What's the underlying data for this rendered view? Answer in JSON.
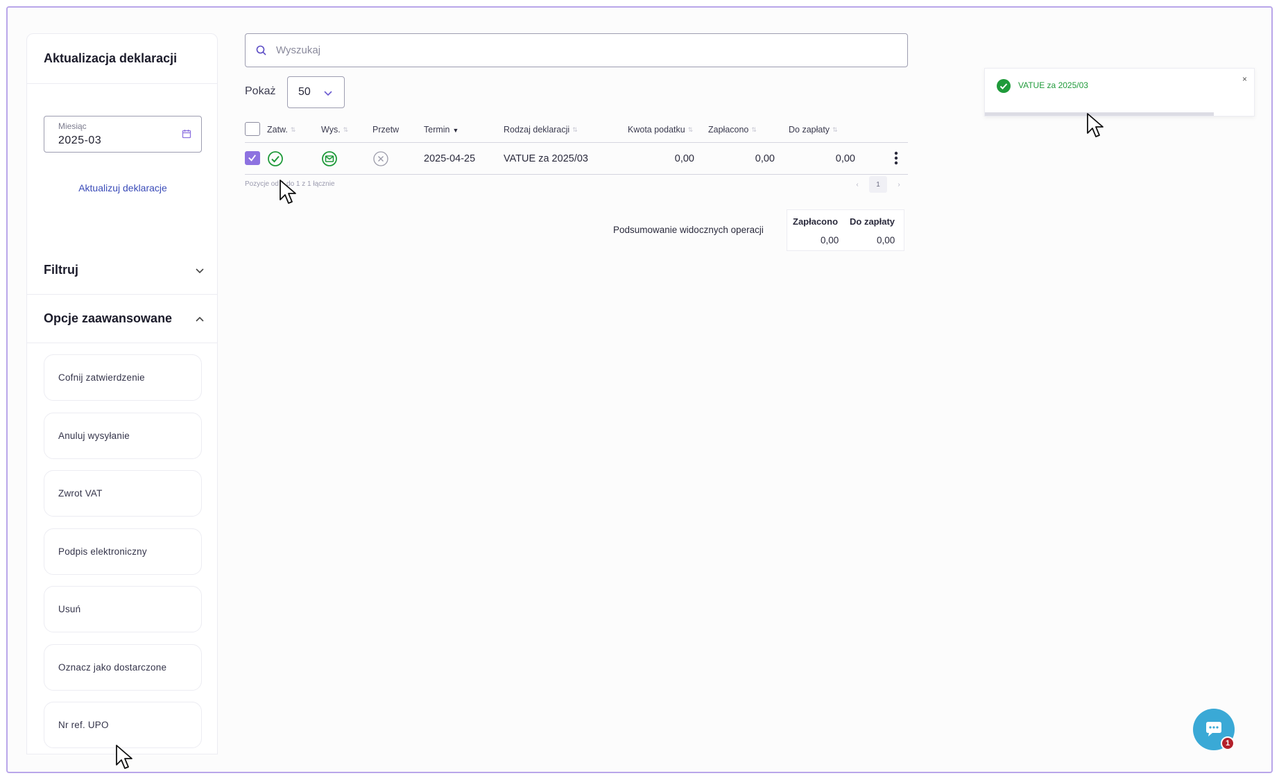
{
  "sidebar": {
    "title": "Aktualizacja deklaracji",
    "month_field": {
      "label": "Miesiąc",
      "value": "2025-03"
    },
    "update_link": "Aktualizuj deklaracje",
    "filter_label": "Filtruj",
    "advanced_label": "Opcje zaawansowane",
    "options": [
      "Cofnij zatwierdzenie",
      "Anuluj wysyłanie",
      "Zwrot VAT",
      "Podpis elektroniczny",
      "Usuń",
      "Oznacz jako dostarczone",
      "Nr ref. UPO"
    ]
  },
  "search": {
    "placeholder": "Wyszukaj"
  },
  "show": {
    "label": "Pokaż",
    "value": "50"
  },
  "table": {
    "columns": {
      "approved": "Zatw.",
      "sent": "Wys.",
      "processed": "Przetw",
      "deadline": "Termin",
      "declaration": "Rodzaj deklaracji",
      "tax_amount": "Kwota podatku",
      "paid": "Zapłacono",
      "to_pay": "Do zapłaty"
    },
    "rows": [
      {
        "checked": true,
        "approved_status": "approved",
        "sent_status": "sent",
        "processed_status": "not-processed",
        "deadline": "2025-04-25",
        "declaration": "VATUE za 2025/03",
        "tax_amount": "0,00",
        "paid": "0,00",
        "to_pay": "0,00"
      }
    ],
    "footer": "Pozycje od 1 do 1 z 1 łącznie",
    "pager": {
      "prev": "‹",
      "current": "1",
      "next": "›"
    }
  },
  "summary": {
    "label": "Podsumowanie widocznych operacji",
    "paid_header": "Zapłacono",
    "to_pay_header": "Do zapłaty",
    "paid_value": "0,00",
    "to_pay_value": "0,00"
  },
  "toast": {
    "message": "VATUE za 2025/03",
    "close": "×",
    "progress": 0.85
  },
  "chat": {
    "badge": "1"
  },
  "colors": {
    "accent": "#8d72e0",
    "frame": "#b9a6ea",
    "success": "#1f9a3a",
    "link": "#3a4bb8",
    "chat": "#3aa9d6",
    "badge": "#b3202a"
  }
}
